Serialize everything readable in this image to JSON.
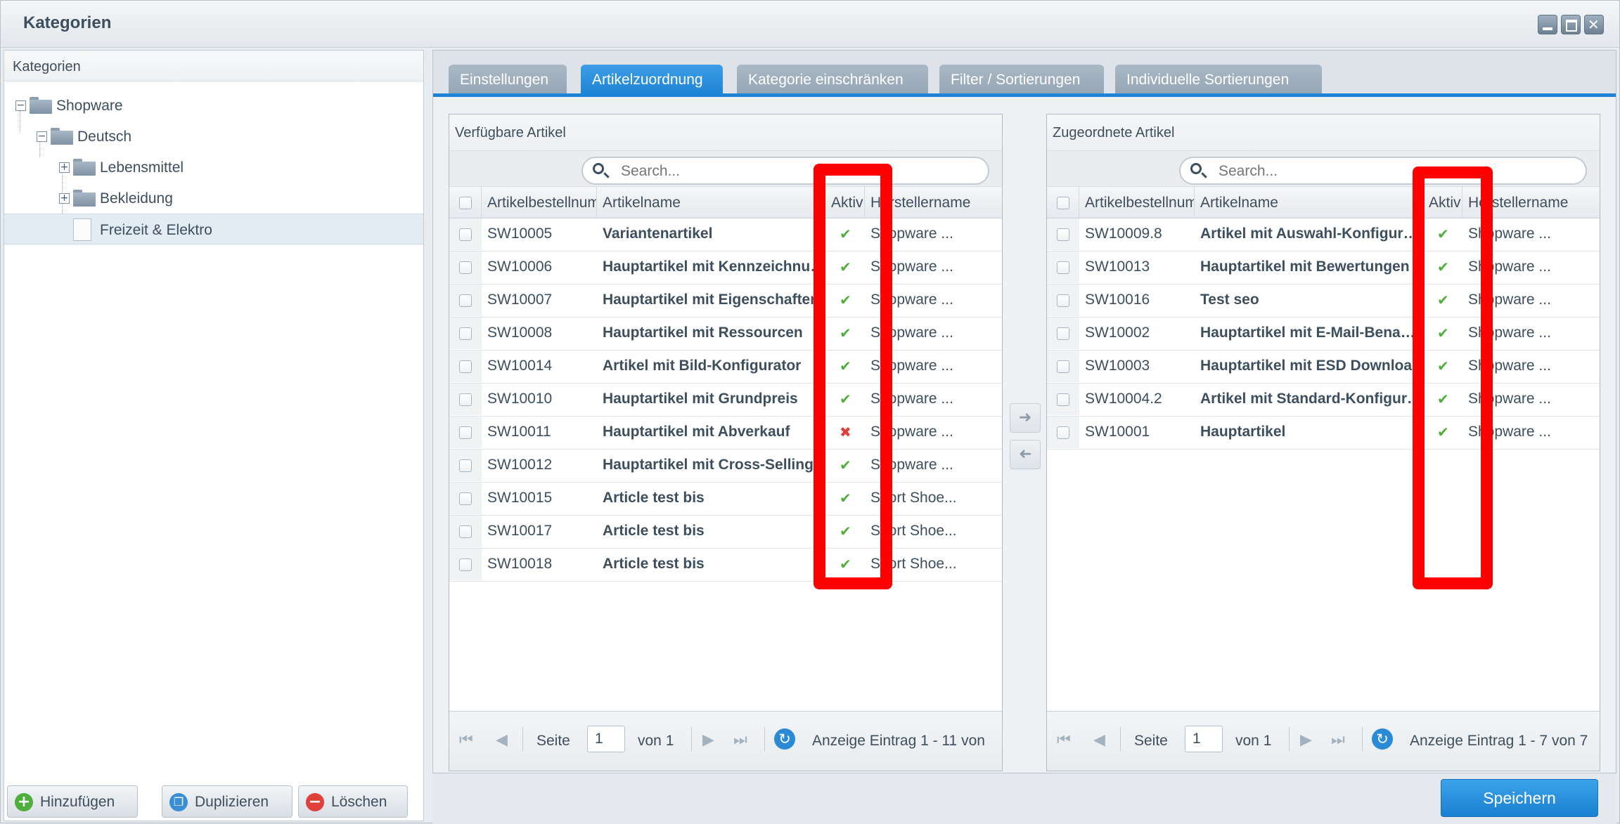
{
  "window": {
    "title": "Kategorien"
  },
  "tree": {
    "header": "Kategorien",
    "nodes": [
      {
        "label": "Shopware",
        "toggle": "−"
      },
      {
        "label": "Deutsch",
        "toggle": "−"
      },
      {
        "label": "Lebensmittel",
        "toggle": "+"
      },
      {
        "label": "Bekleidung",
        "toggle": "+"
      },
      {
        "label": "Freizeit & Elektro"
      }
    ],
    "buttons": {
      "add": "Hinzufügen",
      "duplicate": "Duplizieren",
      "delete": "Löschen"
    }
  },
  "tabs": [
    {
      "label": "Einstellungen"
    },
    {
      "label": "Artikelzuordnung",
      "active": true
    },
    {
      "label": "Kategorie einschränken"
    },
    {
      "label": "Filter / Sortierungen"
    },
    {
      "label": "Individuelle Sortierungen"
    }
  ],
  "columns": {
    "number": "Artikelbestellnummer",
    "name": "Artikelname",
    "active": "Aktiv",
    "manufacturer": "Herstellername"
  },
  "available": {
    "title": "Verfügbare Artikel",
    "search_placeholder": "Search...",
    "rows": [
      {
        "number": "SW10005",
        "name": "Variantenartikel",
        "active": true,
        "manufacturer": "Shopware ..."
      },
      {
        "number": "SW10006",
        "name": "Hauptartikel mit Kennzeichnung",
        "active": true,
        "manufacturer": "Shopware ..."
      },
      {
        "number": "SW10007",
        "name": "Hauptartikel mit Eigenschaften",
        "active": true,
        "manufacturer": "Shopware ..."
      },
      {
        "number": "SW10008",
        "name": "Hauptartikel mit Ressourcen",
        "active": true,
        "manufacturer": "Shopware ..."
      },
      {
        "number": "SW10014",
        "name": "Artikel mit Bild-Konfigurator",
        "active": true,
        "manufacturer": "Shopware ..."
      },
      {
        "number": "SW10010",
        "name": "Hauptartikel mit Grundpreis",
        "active": true,
        "manufacturer": "Shopware ..."
      },
      {
        "number": "SW10011",
        "name": "Hauptartikel mit Abverkauf",
        "active": false,
        "manufacturer": "Shopware ..."
      },
      {
        "number": "SW10012",
        "name": "Hauptartikel mit Cross-Selling",
        "active": true,
        "manufacturer": "Shopware ..."
      },
      {
        "number": "SW10015",
        "name": "Article test bis",
        "active": true,
        "manufacturer": "Sport Shoe..."
      },
      {
        "number": "SW10017",
        "name": "Article test bis",
        "active": true,
        "manufacturer": "Sport Shoe..."
      },
      {
        "number": "SW10018",
        "name": "Article test bis",
        "active": true,
        "manufacturer": "Sport Shoe..."
      }
    ],
    "pager": {
      "page_label": "Seite",
      "page": "1",
      "of": "von 1",
      "display": "Anzeige Eintrag 1 - 11 von"
    }
  },
  "assigned": {
    "title": "Zugeordnete Artikel",
    "search_placeholder": "Search...",
    "rows": [
      {
        "number": "SW10009.8",
        "name": "Artikel mit Auswahl-Konfigurator",
        "active": true,
        "manufacturer": "Shopware ..."
      },
      {
        "number": "SW10013",
        "name": "Hauptartikel mit Bewertungen",
        "active": true,
        "manufacturer": "Shopware ..."
      },
      {
        "number": "SW10016",
        "name": "Test seo",
        "active": true,
        "manufacturer": "Shopware ..."
      },
      {
        "number": "SW10002",
        "name": "Hauptartikel mit E-Mail-Benachrichtigung",
        "active": true,
        "manufacturer": "Shopware ..."
      },
      {
        "number": "SW10003",
        "name": "Hauptartikel mit ESD Download",
        "active": true,
        "manufacturer": "Shopware ..."
      },
      {
        "number": "SW10004.2",
        "name": "Artikel mit Standard-Konfigurator",
        "active": true,
        "manufacturer": "Shopware ..."
      },
      {
        "number": "SW10001",
        "name": "Hauptartikel",
        "active": true,
        "manufacturer": "Shopware ..."
      }
    ],
    "pager": {
      "page_label": "Seite",
      "page": "1",
      "of": "von 1",
      "display": "Anzeige Eintrag 1 - 7 von 7"
    }
  },
  "save_button": "Speichern",
  "colors": {
    "accent": "#1f84d6",
    "highlight": "#ff0000",
    "check": "#4fae3c",
    "cross": "#e0403b"
  }
}
